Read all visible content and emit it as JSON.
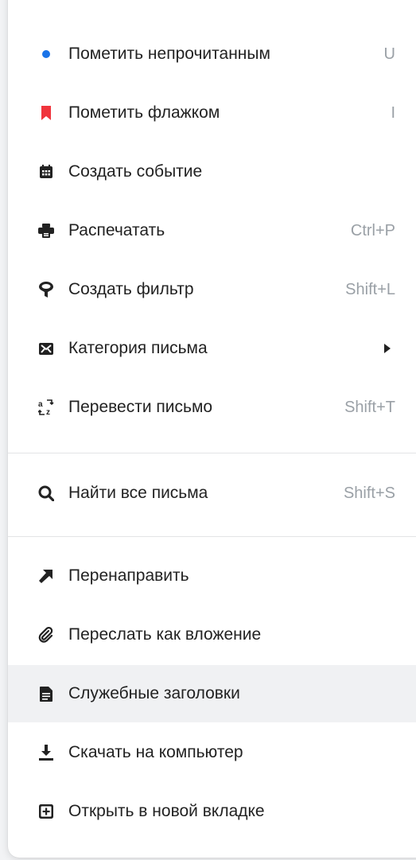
{
  "menu": {
    "items": [
      {
        "label": "Пометить непрочитанным",
        "shortcut": "U",
        "icon": "unread-dot-icon"
      },
      {
        "label": "Пометить флажком",
        "shortcut": "I",
        "icon": "flag-icon"
      },
      {
        "label": "Создать событие",
        "shortcut": "",
        "icon": "calendar-icon"
      },
      {
        "label": "Распечатать",
        "shortcut": "Ctrl+P",
        "icon": "printer-icon"
      },
      {
        "label": "Создать фильтр",
        "shortcut": "Shift+L",
        "icon": "filter-icon"
      },
      {
        "label": "Категория письма",
        "shortcut": "",
        "icon": "category-envelope-icon",
        "submenu": true
      },
      {
        "label": "Перевести письмо",
        "shortcut": "Shift+T",
        "icon": "translate-icon"
      },
      {
        "label": "Найти все письма",
        "shortcut": "Shift+S",
        "icon": "search-icon"
      },
      {
        "label": "Перенаправить",
        "shortcut": "",
        "icon": "redirect-arrow-icon"
      },
      {
        "label": "Переслать как вложение",
        "shortcut": "",
        "icon": "paperclip-icon"
      },
      {
        "label": "Служебные заголовки",
        "shortcut": "",
        "icon": "document-icon"
      },
      {
        "label": "Скачать на компьютер",
        "shortcut": "",
        "icon": "download-icon"
      },
      {
        "label": "Открыть в новой вкладке",
        "shortcut": "",
        "icon": "new-tab-icon"
      }
    ]
  },
  "colors": {
    "unread_dot": "#1a73e8",
    "flag": "#f0343c",
    "icon": "#222222",
    "shortcut": "#9aa0a6",
    "highlight": "#f0f1f3"
  }
}
